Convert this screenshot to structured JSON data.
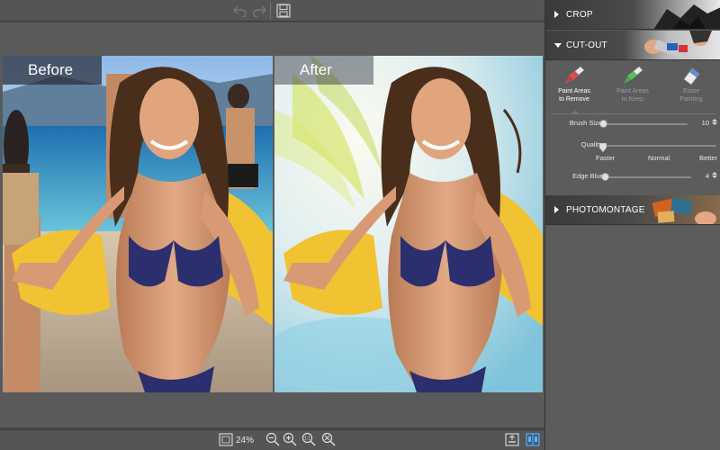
{
  "toolbar": {
    "undo_icon": "undo-arrow-icon",
    "redo_icon": "redo-arrow-icon",
    "save_icon": "floppy-disk-icon"
  },
  "canvas": {
    "before_label": "Before",
    "after_label": "After"
  },
  "bottombar": {
    "zoom_value": "24%",
    "icons": [
      "fit-to-window-icon",
      "zoom-out-icon",
      "zoom-in-icon",
      "actual-size-icon",
      "zoom-fit-icon",
      "export-icon",
      "split-view-icon"
    ]
  },
  "panel": {
    "crop": {
      "label": "CROP",
      "expanded": false
    },
    "cutout": {
      "label": "CUT-OUT",
      "expanded": true,
      "tools": [
        {
          "label_line1": "Paint Areas",
          "label_line2": "to Remove",
          "icon": "red-marker-icon",
          "active": true
        },
        {
          "label_line1": "Paint Areas",
          "label_line2": "to Keep",
          "icon": "green-marker-icon",
          "active": false
        },
        {
          "label_line1": "Erase",
          "label_line2": "Painting",
          "icon": "eraser-icon",
          "active": false
        }
      ],
      "brush_size": {
        "label": "Brush Size",
        "value": "10",
        "fraction": 0.0
      },
      "quality": {
        "label": "Quality",
        "marks": [
          "Faster",
          "Normal",
          "Better"
        ],
        "fraction": 0.0
      },
      "edge_blur": {
        "label": "Edge Blur",
        "value": "4",
        "fraction": 0.0
      }
    },
    "photomontage": {
      "label": "PHOTOMONTAGE",
      "expanded": false
    }
  },
  "colors": {
    "accent": "#6bb0e6",
    "panel_bg": "#5c5c5c",
    "bikini": "#2b2f6e",
    "scarf": "#f1c232"
  }
}
